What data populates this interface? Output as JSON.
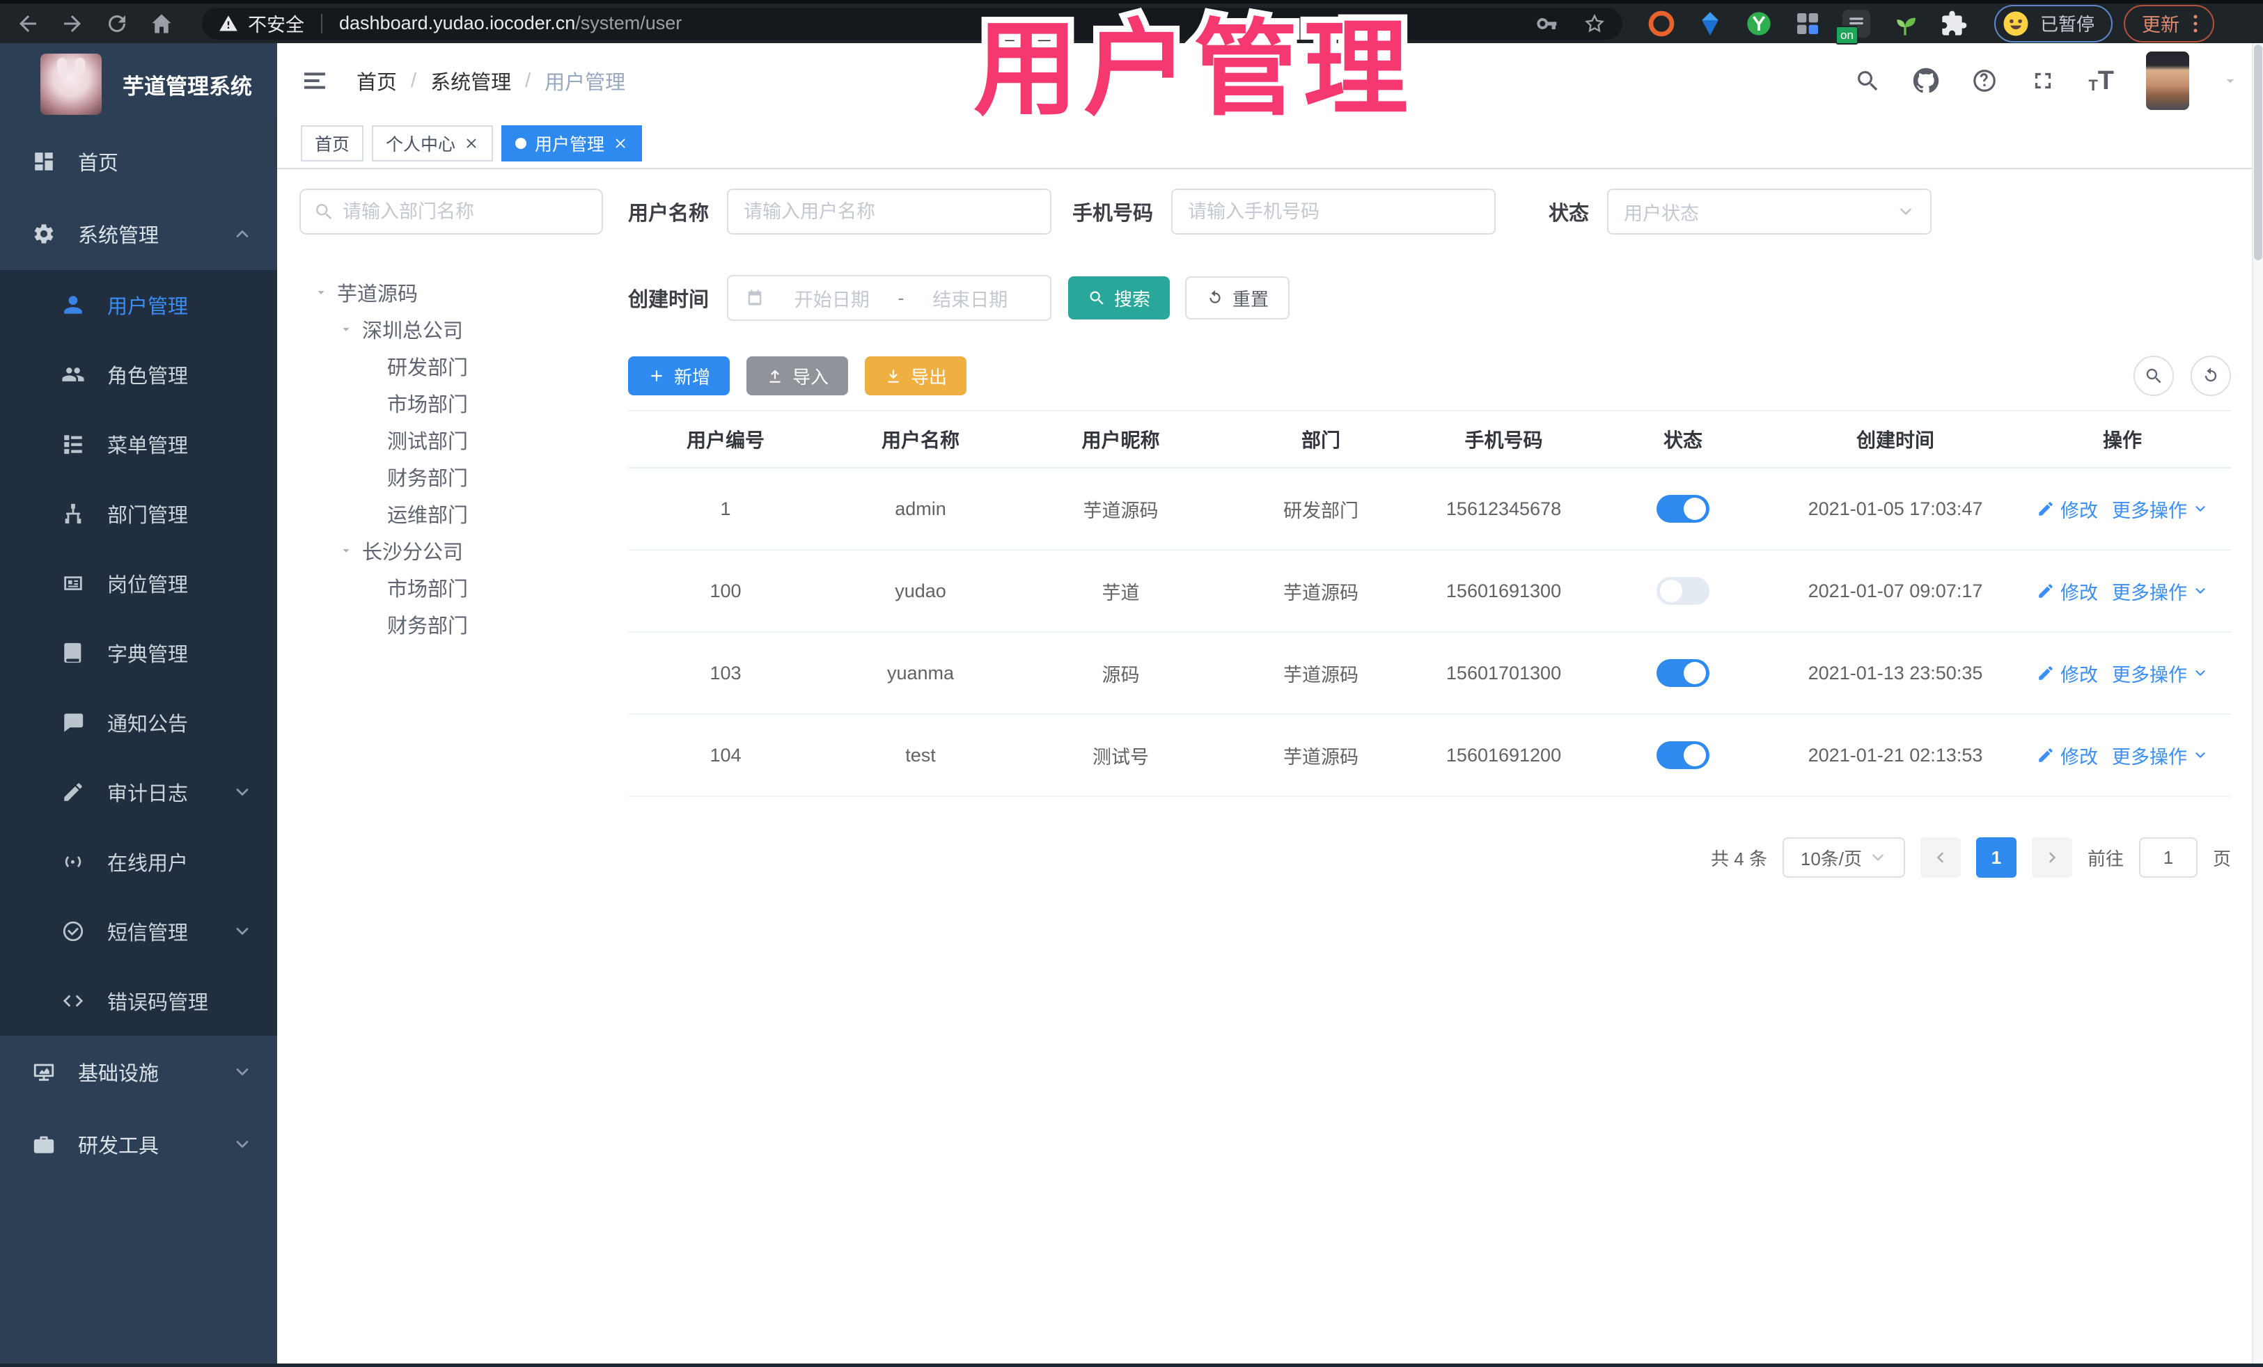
{
  "colors": {
    "primary": "#2f8af0",
    "link": "#3a8ef6",
    "search_teal": "#2aa79b",
    "export_orange": "#efb041",
    "import_gray": "#909399",
    "sidebar_bg": "#2d3f54",
    "submenu_bg": "#202e3f",
    "overlay_pink": "#f5386f",
    "tag_active": "#2f8af0",
    "toggle_on": "#2f8af0"
  },
  "browser": {
    "security_label": "不安全",
    "url_host": "dashboard.yudao.iocoder.cn",
    "url_path": "/system/user",
    "ext_on_badge": "on",
    "profile_status": "已暂停",
    "update_label": "更新"
  },
  "overlay_title": "用户管理",
  "sidebar": {
    "title": "芋道管理系统",
    "items": [
      {
        "label": "首页",
        "icon": "dashboard",
        "variant": "top"
      },
      {
        "label": "系统管理",
        "icon": "gear",
        "variant": "top",
        "chevron": "up"
      },
      {
        "label": "用户管理",
        "icon": "user",
        "variant": "sub",
        "active": true
      },
      {
        "label": "角色管理",
        "icon": "users",
        "variant": "sub"
      },
      {
        "label": "菜单管理",
        "icon": "tree",
        "variant": "sub"
      },
      {
        "label": "部门管理",
        "icon": "org",
        "variant": "sub"
      },
      {
        "label": "岗位管理",
        "icon": "badge",
        "variant": "sub"
      },
      {
        "label": "字典管理",
        "icon": "book",
        "variant": "sub"
      },
      {
        "label": "通知公告",
        "icon": "notice",
        "variant": "sub"
      },
      {
        "label": "审计日志",
        "icon": "editlog",
        "variant": "sub",
        "chevron": "down"
      },
      {
        "label": "在线用户",
        "icon": "online",
        "variant": "sub"
      },
      {
        "label": "短信管理",
        "icon": "checkcircle",
        "variant": "sub",
        "chevron": "down"
      },
      {
        "label": "错误码管理",
        "icon": "code",
        "variant": "sub"
      },
      {
        "label": "基础设施",
        "icon": "infra",
        "variant": "top",
        "chevron": "down"
      },
      {
        "label": "研发工具",
        "icon": "toolbox",
        "variant": "top",
        "chevron": "down"
      }
    ]
  },
  "header": {
    "breadcrumb": [
      "首页",
      "系统管理",
      "用户管理"
    ],
    "breadcrumb_sep": "/",
    "font_small": "T",
    "font_big": "T"
  },
  "tags": [
    {
      "label": "首页"
    },
    {
      "label": "个人中心",
      "closable": true
    },
    {
      "label": "用户管理",
      "closable": true,
      "active": true
    }
  ],
  "dept": {
    "placeholder": "请输入部门名称",
    "nodes": [
      {
        "label": "芋道源码",
        "level": "lv0",
        "caret": true
      },
      {
        "label": "深圳总公司",
        "level": "lv1",
        "caret": true
      },
      {
        "label": "研发部门",
        "level": "lv2"
      },
      {
        "label": "市场部门",
        "level": "lv2"
      },
      {
        "label": "测试部门",
        "level": "lv2"
      },
      {
        "label": "财务部门",
        "level": "lv2"
      },
      {
        "label": "运维部门",
        "level": "lv2"
      },
      {
        "label": "长沙分公司",
        "level": "lv1",
        "caret": true
      },
      {
        "label": "市场部门",
        "level": "lv2"
      },
      {
        "label": "财务部门",
        "level": "lv2"
      }
    ]
  },
  "filters": {
    "username_label": "用户名称",
    "username_placeholder": "请输入用户名称",
    "mobile_label": "手机号码",
    "mobile_placeholder": "请输入手机号码",
    "status_label": "状态",
    "status_placeholder": "用户状态",
    "created_label": "创建时间",
    "date_start": "开始日期",
    "date_sep": "-",
    "date_end": "结束日期",
    "search": "搜索",
    "reset": "重置"
  },
  "toolbar": {
    "add": "新增",
    "imp": "导入",
    "exp": "导出"
  },
  "table": {
    "columns": [
      "用户编号",
      "用户名称",
      "用户昵称",
      "部门",
      "手机号码",
      "状态",
      "创建时间",
      "操作"
    ],
    "action_edit": "修改",
    "action_more": "更多操作",
    "rows": [
      {
        "id": "1",
        "username": "admin",
        "nickname": "芋道源码",
        "dept": "研发部门",
        "mobile": "15612345678",
        "status": true,
        "created": "2021-01-05 17:03:47"
      },
      {
        "id": "100",
        "username": "yudao",
        "nickname": "芋道",
        "dept": "芋道源码",
        "mobile": "15601691300",
        "status": false,
        "created": "2021-01-07 09:07:17"
      },
      {
        "id": "103",
        "username": "yuanma",
        "nickname": "源码",
        "dept": "芋道源码",
        "mobile": "15601701300",
        "status": true,
        "created": "2021-01-13 23:50:35"
      },
      {
        "id": "104",
        "username": "test",
        "nickname": "测试号",
        "dept": "芋道源码",
        "mobile": "15601691200",
        "status": true,
        "created": "2021-01-21 02:13:53"
      }
    ]
  },
  "pagination": {
    "total": "共 4 条",
    "page_size": "10条/页",
    "current": "1",
    "goto_label": "前往",
    "goto_value": "1",
    "unit": "页"
  }
}
